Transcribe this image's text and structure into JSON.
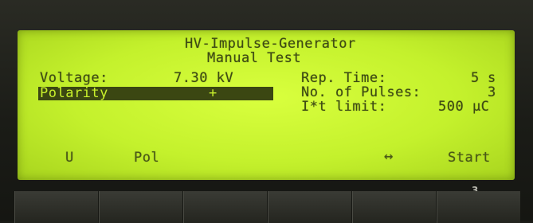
{
  "display": {
    "title": "HV-Impulse-Generator",
    "subtitle": "Manual Test",
    "voltage_label": "Voltage:",
    "voltage_value": "7.30 kV",
    "polarity_label": "Polarity",
    "polarity_value": "+",
    "rep_time_label": "Rep. Time:",
    "rep_time_value": "5",
    "rep_time_unit": "s",
    "pulses_label": "No. of Pulses:",
    "pulses_value": "3",
    "it_limit_label": "I*t limit:",
    "it_limit_value": "500 µC"
  },
  "softkeys": [
    "U",
    "Pol",
    "↔",
    "Start"
  ],
  "page_number": "3"
}
